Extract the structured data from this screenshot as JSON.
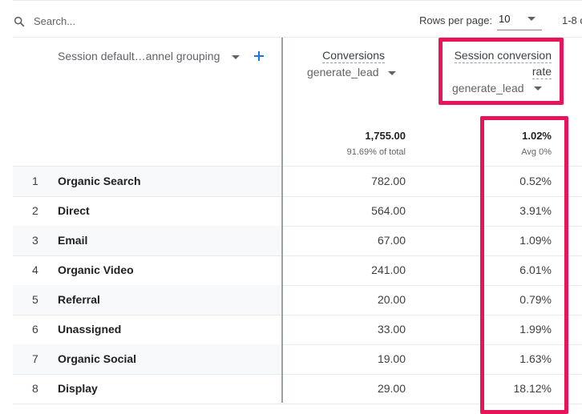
{
  "search": {
    "placeholder": "Search..."
  },
  "pagination": {
    "rows_per_page_label": "Rows per page:",
    "rows_per_page_value": "10",
    "range_text": "1-8 o"
  },
  "table": {
    "dimension_header": "Session default…annel grouping",
    "columns": [
      {
        "title_lines": [
          "Conversions"
        ],
        "event": "generate_lead",
        "total": "1,755.00",
        "total_sub": "91.69% of total"
      },
      {
        "title_lines": [
          "Session conversion",
          "rate"
        ],
        "event": "generate_lead",
        "total": "1.02%",
        "total_sub": "Avg 0%"
      }
    ],
    "rows": [
      {
        "index": "1",
        "name": "Organic Search",
        "conversions": "782.00",
        "rate": "0.52%"
      },
      {
        "index": "2",
        "name": "Direct",
        "conversions": "564.00",
        "rate": "3.91%"
      },
      {
        "index": "3",
        "name": "Email",
        "conversions": "67.00",
        "rate": "1.09%"
      },
      {
        "index": "4",
        "name": "Organic Video",
        "conversions": "241.00",
        "rate": "6.01%"
      },
      {
        "index": "5",
        "name": "Referral",
        "conversions": "20.00",
        "rate": "0.79%"
      },
      {
        "index": "6",
        "name": "Unassigned",
        "conversions": "33.00",
        "rate": "1.99%"
      },
      {
        "index": "7",
        "name": "Organic Social",
        "conversions": "19.00",
        "rate": "1.63%"
      },
      {
        "index": "8",
        "name": "Display",
        "conversions": "29.00",
        "rate": "18.12%"
      }
    ]
  },
  "icons": {
    "search": "search-icon",
    "add": "plus-icon",
    "dropdown": "chevron-down-icon"
  },
  "colors": {
    "highlight": "#e8145a",
    "accent": "#1a73e8",
    "row_shade": "#f8f9fa"
  }
}
